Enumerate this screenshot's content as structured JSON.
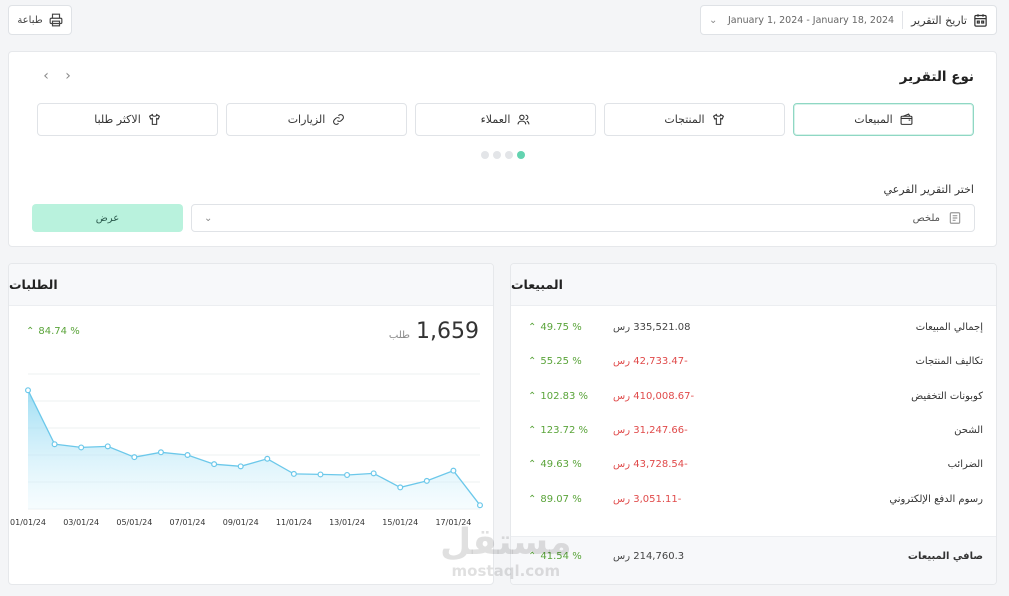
{
  "toolbar": {
    "print_label": "طباعة",
    "date_label": "تاريخ التقرير",
    "date_range": "January 1, 2024 - January 18, 2024"
  },
  "report": {
    "title": "نوع التقرير",
    "tabs": [
      {
        "label": "المبيعات",
        "icon": "wallet-icon",
        "active": true
      },
      {
        "label": "المنتجات",
        "icon": "shirt-icon",
        "active": false
      },
      {
        "label": "العملاء",
        "icon": "users-icon",
        "active": false
      },
      {
        "label": "الزيارات",
        "icon": "link-icon",
        "active": false
      },
      {
        "label": "الاكثر طلبا",
        "icon": "shirt-icon",
        "active": false
      }
    ],
    "page_dots": 4,
    "active_dot": 0,
    "sub_label": "اختر التقرير الفرعي",
    "sub_value": "ملخص",
    "view_label": "عرض"
  },
  "sales": {
    "title": "المبيعات",
    "rows": [
      {
        "name": "إجمالي المبيعات",
        "amount": "335,521.08 رس",
        "negative": false,
        "pct": "49.75 %"
      },
      {
        "name": "تكاليف المنتجات",
        "amount": "-42,733.47 رس",
        "negative": true,
        "pct": "55.25 %"
      },
      {
        "name": "كوبونات التخفيض",
        "amount": "-410,008.67 رس",
        "negative": true,
        "pct": "102.83 %"
      },
      {
        "name": "الشحن",
        "amount": "-31,247.66 رس",
        "negative": true,
        "pct": "123.72 %"
      },
      {
        "name": "الضرائب",
        "amount": "-43,728.54 رس",
        "negative": true,
        "pct": "49.63 %"
      },
      {
        "name": "رسوم الدفع الإلكتروني",
        "amount": "-3,051.11 رس",
        "negative": true,
        "pct": "89.07 %"
      }
    ],
    "net": {
      "name": "صافي المبيعات",
      "amount": "214,760.3 رس",
      "pct": "41.54 %"
    }
  },
  "orders": {
    "title": "الطلبات",
    "total": "1,659",
    "unit": "طلب",
    "change": "84.74 %"
  },
  "chart_data": {
    "type": "area",
    "x": [
      "01/01/24",
      "02/01/24",
      "03/01/24",
      "04/01/24",
      "05/01/24",
      "06/01/24",
      "07/01/24",
      "08/01/24",
      "09/01/24",
      "10/01/24",
      "11/01/24",
      "12/01/24",
      "13/01/24",
      "14/01/24",
      "15/01/24",
      "16/01/24",
      "17/01/24",
      "18/01/24"
    ],
    "tick_labels": [
      "01/01/24",
      "03/01/24",
      "05/01/24",
      "07/01/24",
      "09/01/24",
      "11/01/24",
      "13/01/24",
      "15/01/24",
      "17/01/24"
    ],
    "values": [
      220,
      120,
      114,
      116,
      96,
      105,
      100,
      83,
      79,
      93,
      65,
      64,
      63,
      66,
      40,
      52,
      71,
      7
    ],
    "ylim": [
      0,
      250
    ],
    "grid": true,
    "color": "#7fd3f0"
  },
  "watermark": {
    "arabic": "مستقل",
    "latin": "mostaql.com"
  }
}
